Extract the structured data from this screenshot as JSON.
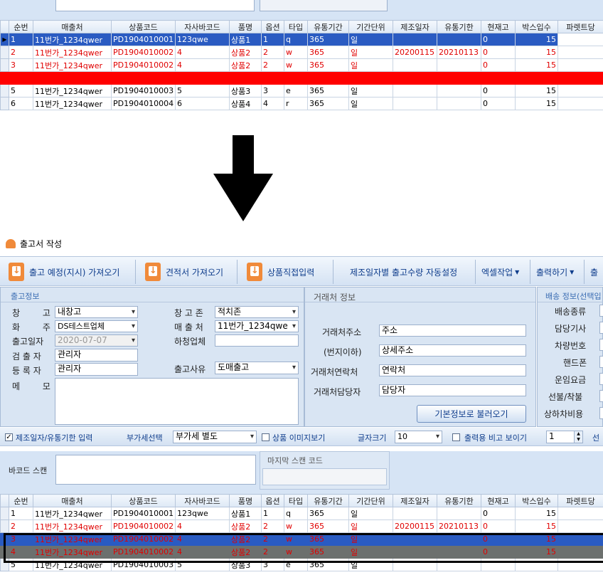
{
  "grid_columns": [
    "순번",
    "매출처",
    "상품코드",
    "자사바코드",
    "품명",
    "옵션",
    "타입",
    "유통기간",
    "기간단위",
    "제조일자",
    "유통기한",
    "현재고",
    "박스입수",
    "파렛트당"
  ],
  "top_grid_rows": [
    {
      "no": "1",
      "store": "11번가_1234qwer",
      "code": "PD1904010001",
      "barcode": "123qwe",
      "name": "상품1",
      "opt": "1",
      "type": "q",
      "period": "365",
      "unit": "일",
      "mfg": "",
      "exp": "",
      "stock": "0",
      "box": "15"
    },
    {
      "no": "2",
      "store": "11번가_1234qwer",
      "code": "PD1904010002",
      "barcode": "4",
      "name": "상품2",
      "opt": "2",
      "type": "w",
      "period": "365",
      "unit": "일",
      "mfg": "20200115",
      "exp": "20210113",
      "stock": "0",
      "box": "15"
    },
    {
      "no": "3",
      "store": "11번가_1234qwer",
      "code": "PD1904010002",
      "barcode": "4",
      "name": "상품2",
      "opt": "2",
      "type": "w",
      "period": "365",
      "unit": "일",
      "mfg": "",
      "exp": "",
      "stock": "0",
      "box": "15"
    },
    {
      "no": "",
      "store": "",
      "code": "",
      "barcode": "",
      "name": "",
      "opt": "",
      "type": "",
      "period": "",
      "unit": "",
      "mfg": "",
      "exp": "",
      "stock": "",
      "box": ""
    },
    {
      "no": "5",
      "store": "11번가_1234qwer",
      "code": "PD1904010003",
      "barcode": "5",
      "name": "상품3",
      "opt": "3",
      "type": "e",
      "period": "365",
      "unit": "일",
      "mfg": "",
      "exp": "",
      "stock": "0",
      "box": "15"
    },
    {
      "no": "6",
      "store": "11번가_1234qwer",
      "code": "PD1904010004",
      "barcode": "6",
      "name": "상품4",
      "opt": "4",
      "type": "r",
      "period": "365",
      "unit": "일",
      "mfg": "",
      "exp": "",
      "stock": "0",
      "box": "15"
    }
  ],
  "window_title": "출고서 작성",
  "toolbar": {
    "btn1": "출고 예정(지시) 가져오기",
    "btn2": "견적서 가져오기",
    "btn3": "상품직접입력",
    "btn4": "제조일자별 출고수량 자동설정",
    "btn5": "엑셀작업",
    "btn6": "출력하기",
    "btn7": "출"
  },
  "outgoing": {
    "title": "출고정보",
    "warehouse_label": "창 고",
    "warehouse": "내창고",
    "zone_label": "창 고 존",
    "zone": "적치존",
    "owner_label": "화 주",
    "owner": "DS테스트업체",
    "store_label": "매 출 처",
    "store": "11번가_1234qwe",
    "date_label": "출고일자",
    "date": "2020-07-07",
    "vendor_label": "하청업체",
    "vendor": "",
    "inspector_label": "검 출 자",
    "inspector": "관리자",
    "reason_label": "출고사유",
    "reason": "도매출고",
    "register_label": "등 록 자",
    "register": "관리자",
    "memo_label": "메 모"
  },
  "partner": {
    "title": "거래처 정보",
    "addr_label": "거래처주소",
    "addr": "주소",
    "addr2_label": "(번지이하)",
    "addr2": "상세주소",
    "phone_label": "거래처연락처",
    "phone": "연락처",
    "person_label": "거래처담당자",
    "person": "담당자",
    "load_btn": "기본정보로 불러오기"
  },
  "delivery": {
    "title": "배송 정보(선택입",
    "labels": [
      "배송종류",
      "담당기사",
      "차량번호",
      "핸드폰",
      "운임요금",
      "선불/착불",
      "상하차비용"
    ]
  },
  "options_bar": {
    "mfg_check": "제조일자/유통기한 입력",
    "vat_label": "부가세선택",
    "vat": "부가세 별도",
    "img_check": "상품 이미지보기",
    "font_label": "글자크기",
    "font": "10",
    "print_check": "출력용 비고 보이기",
    "spin": "1",
    "trail": "선"
  },
  "scan": {
    "barcode_label": "바코드 스캔",
    "last_label": "마지막 스캔 코드"
  },
  "bottom_grid_rows": [
    {
      "no": "1",
      "store": "11번가_1234qwer",
      "code": "PD1904010001",
      "barcode": "123qwe",
      "name": "상품1",
      "opt": "1",
      "type": "q",
      "period": "365",
      "unit": "일",
      "mfg": "",
      "exp": "",
      "stock": "0",
      "box": "15"
    },
    {
      "no": "2",
      "store": "11번가_1234qwer",
      "code": "PD1904010002",
      "barcode": "4",
      "name": "상품2",
      "opt": "2",
      "type": "w",
      "period": "365",
      "unit": "일",
      "mfg": "20200115",
      "exp": "20210113",
      "stock": "0",
      "box": "15"
    },
    {
      "no": "3",
      "store": "11번가_1234qwer",
      "code": "PD1904010002",
      "barcode": "4",
      "name": "상품2",
      "opt": "2",
      "type": "w",
      "period": "365",
      "unit": "일",
      "mfg": "",
      "exp": "",
      "stock": "0",
      "box": "15"
    },
    {
      "no": "4",
      "store": "11번가_1234qwer",
      "code": "PD1904010002",
      "barcode": "4",
      "name": "상품2",
      "opt": "2",
      "type": "w",
      "period": "365",
      "unit": "일",
      "mfg": "",
      "exp": "",
      "stock": "0",
      "box": "15"
    },
    {
      "no": "5",
      "store": "11번가_1234qwer",
      "code": "PD1904010003",
      "barcode": "5",
      "name": "상품3",
      "opt": "3",
      "type": "e",
      "period": "365",
      "unit": "일",
      "mfg": "",
      "exp": "",
      "stock": "",
      "box": ""
    }
  ],
  "colors": {
    "selected_row": "#2a5bc2",
    "highlight_red": "#ff0000",
    "text_red": "#e00000",
    "panel_bg": "#d9e5f3",
    "arrow": "#000000"
  }
}
